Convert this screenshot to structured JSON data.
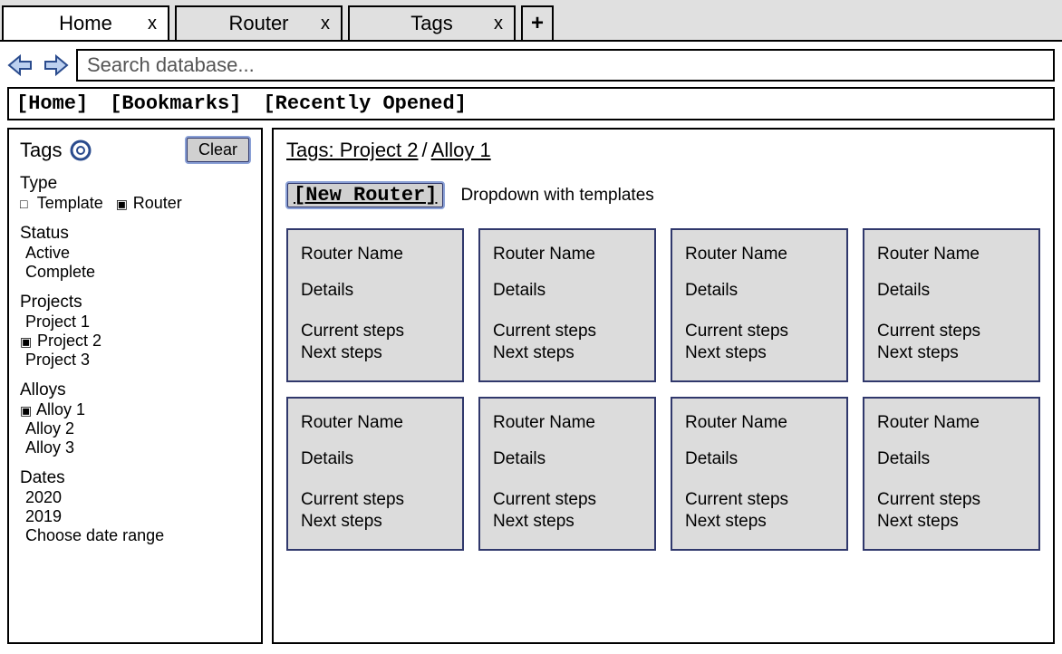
{
  "tabs": [
    {
      "label": "Home",
      "close": "x",
      "active": true
    },
    {
      "label": "Router",
      "close": "x",
      "active": false
    },
    {
      "label": "Tags",
      "close": "x",
      "active": false
    }
  ],
  "addTab": "+",
  "search": {
    "placeholder": "Search database..."
  },
  "secnav": {
    "home": "[Home]",
    "bookmarks": "[Bookmarks]",
    "recent": "[Recently Opened]"
  },
  "sidebar": {
    "title": "Tags",
    "clear": "Clear",
    "type": {
      "heading": "Type",
      "template": {
        "label": "Template",
        "checked": false
      },
      "router": {
        "label": "Router",
        "checked": true
      }
    },
    "status": {
      "heading": "Status",
      "items": [
        "Active",
        "Complete"
      ]
    },
    "projects": {
      "heading": "Projects",
      "items": [
        {
          "label": "Project 1",
          "checked": false
        },
        {
          "label": "Project 2",
          "checked": true
        },
        {
          "label": "Project 3",
          "checked": false
        }
      ]
    },
    "alloys": {
      "heading": "Alloys",
      "items": [
        {
          "label": "Alloy 1",
          "checked": true
        },
        {
          "label": "Alloy 2",
          "checked": false
        },
        {
          "label": "Alloy 3",
          "checked": false
        }
      ]
    },
    "dates": {
      "heading": "Dates",
      "items": [
        "2020",
        "2019",
        "Choose date range"
      ]
    }
  },
  "main": {
    "breadcrumb": {
      "root": "Tags: Project 2",
      "leaf": "Alloy 1"
    },
    "newRouter": "[New Router]",
    "dropdownNote": "Dropdown with templates",
    "card": {
      "name": "Router Name",
      "details": "Details",
      "current": "Current steps",
      "next": "Next steps"
    },
    "cardCount": 8
  }
}
